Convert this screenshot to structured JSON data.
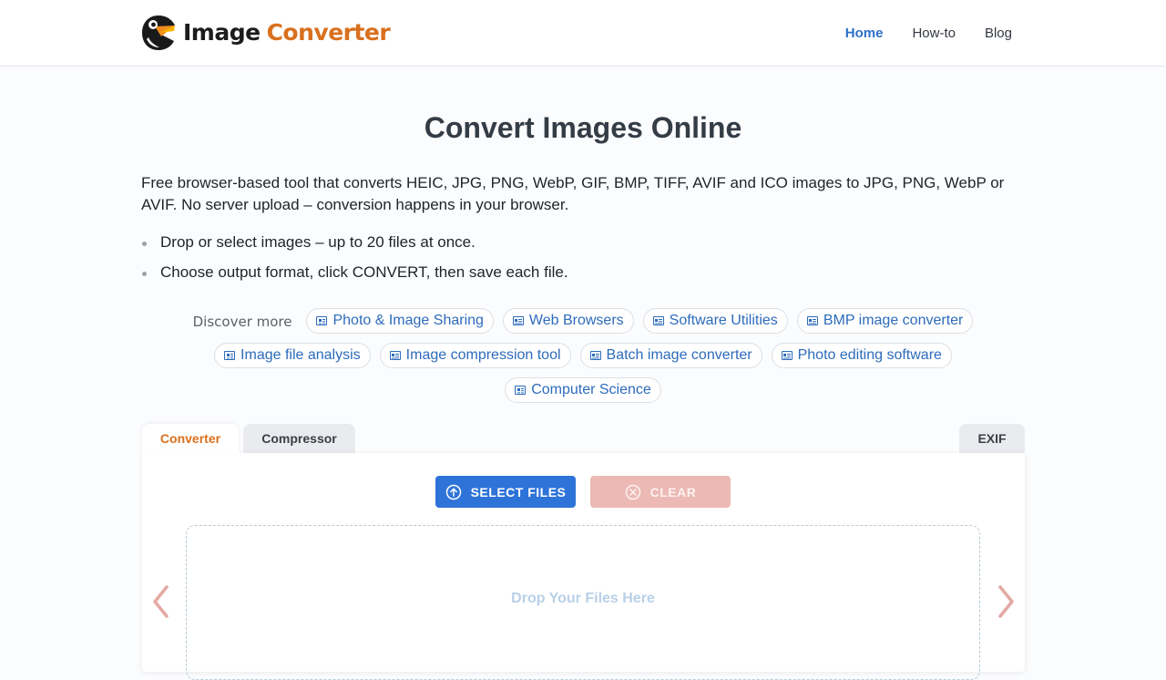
{
  "header": {
    "logo_word1": "Image",
    "logo_word2": "Converter",
    "nav": [
      {
        "label": "Home",
        "active": true
      },
      {
        "label": "How-to",
        "active": false
      },
      {
        "label": "Blog",
        "active": false
      }
    ]
  },
  "main": {
    "title": "Convert Images Online",
    "intro": "Free browser-based tool that converts HEIC, JPG, PNG, WebP, GIF, BMP, TIFF, AVIF and ICO images to JPG, PNG, WebP or AVIF. No server upload – conversion happens in your browser.",
    "bullets": [
      "Drop or select images – up to 20 files at once.",
      "Choose output format, click CONVERT, then save each file."
    ]
  },
  "discover": {
    "label": "Discover more",
    "chips": [
      "Photo & Image Sharing",
      "Web Browsers",
      "Software Utilities",
      "BMP image converter",
      "Image file analysis",
      "Image compression tool",
      "Batch image converter",
      "Photo editing software",
      "Computer Science"
    ]
  },
  "tabs": {
    "converter": "Converter",
    "compressor": "Compressor",
    "exif": "EXIF"
  },
  "tool": {
    "select_label": "SELECT FILES",
    "clear_label": "CLEAR",
    "dropzone_text": "Drop Your Files Here"
  },
  "colors": {
    "accent_blue": "#2e73d8",
    "accent_orange": "#d9701e",
    "clear_button": "#ecb9b4",
    "arrow": "#e3a9a2"
  },
  "icons": {
    "logo": "toucan-icon",
    "chip": "newspaper-icon",
    "select": "upload-circle-icon",
    "clear": "x-circle-icon",
    "prev": "chevron-left-icon",
    "next": "chevron-right-icon"
  }
}
